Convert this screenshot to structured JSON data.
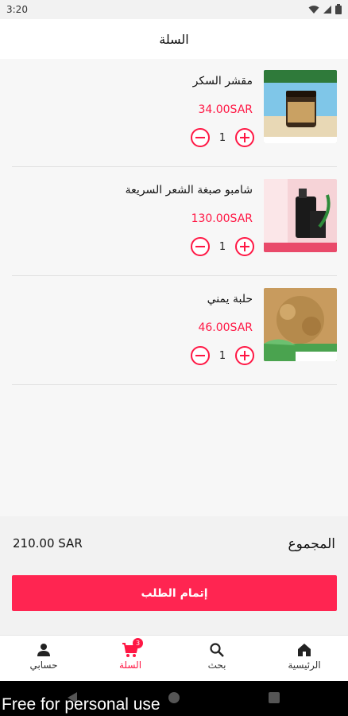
{
  "status_bar": {
    "time": "3:20"
  },
  "app_bar": {
    "title": "السلة"
  },
  "cart": {
    "items": [
      {
        "name": "مقشر السكر",
        "price": "34.00SAR",
        "quantity": "1",
        "thumb_color": "#c9a163"
      },
      {
        "name": "شامبو صبغة الشعر السريعة",
        "price": "130.00SAR",
        "quantity": "1",
        "thumb_color": "#f3c9cf"
      },
      {
        "name": "حلبة يمني",
        "price": "46.00SAR",
        "quantity": "1",
        "thumb_color": "#b58a4c"
      }
    ]
  },
  "summary": {
    "total_label": "المجموع",
    "total_value": "210.00 SAR"
  },
  "checkout": {
    "label": "إتمام الطلب"
  },
  "bottom_nav": {
    "items": [
      {
        "label": "حسابي",
        "icon": "person-icon"
      },
      {
        "label": "السلة",
        "icon": "cart-icon",
        "badge": "3"
      },
      {
        "label": "بحث",
        "icon": "search-icon"
      },
      {
        "label": "الرئيسية",
        "icon": "home-icon"
      }
    ],
    "active_color": "#ff1744"
  },
  "watermark": "Free for personal use",
  "colors": {
    "accent": "#ff1744",
    "button": "#ff2551"
  }
}
